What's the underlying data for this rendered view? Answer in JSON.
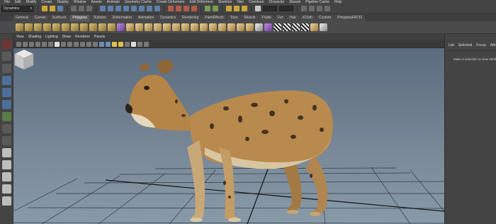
{
  "menubar": {
    "items": [
      "File",
      "Edit",
      "Modify",
      "Create",
      "Display",
      "Window",
      "Assets",
      "Animate",
      "Geometry Cache",
      "Create Deformers",
      "Edit Deformers",
      "Skeleton",
      "Skin",
      "Constrain",
      "Character",
      "Muscle",
      "Pipeline Cache",
      "Help"
    ]
  },
  "statusline": {
    "mode": "Dynamics"
  },
  "shelf": {
    "tabs": [
      "General",
      "Curves",
      "Surfaces",
      "Polygons",
      "Subdivs",
      "Deformation",
      "Animation",
      "Dynamics",
      "Rendering",
      "PaintEffects",
      "Toon",
      "Muscle",
      "Fluids",
      "Fur",
      "Hair",
      "nCloth",
      "Custom",
      "PolygonsFAT32"
    ],
    "active_tab": "Polygons"
  },
  "viewport": {
    "menu": [
      "View",
      "Shading",
      "Lighting",
      "Show",
      "Renderer",
      "Panels"
    ]
  },
  "right_panel": {
    "tabs": [
      "List",
      "Selected",
      "Focus",
      "Attributes"
    ],
    "message": "Make a selection to view attributes"
  },
  "colors": {
    "ui_background": "#444444",
    "viewport_top": "#5b6c80",
    "viewport_bottom": "#889aa8",
    "grid": "#222a35",
    "tiger_fur": "#b98a4e"
  }
}
